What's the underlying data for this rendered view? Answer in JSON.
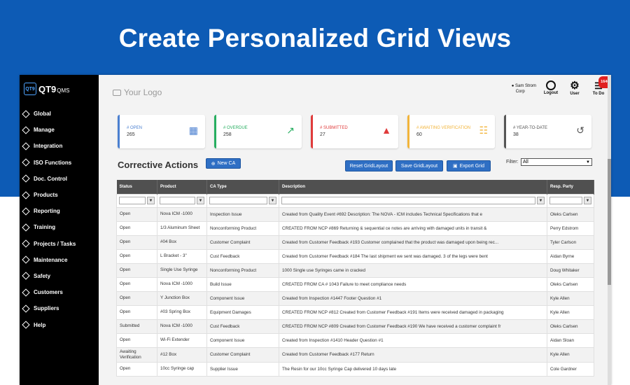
{
  "banner": {
    "title": "Create Personalized Grid Views"
  },
  "app": {
    "logo": {
      "badge": "QT9",
      "name": "QT9",
      "suffix": "QMS"
    },
    "your_logo": "Your Logo",
    "user": {
      "name": "Sam Strom",
      "org": "Corp"
    },
    "toolbar": {
      "logout": "Logout",
      "user": "User",
      "todo": "To Do",
      "todo_count": "1640"
    },
    "nav": [
      "Global",
      "Manage",
      "Integration",
      "ISO Functions",
      "Doc. Control",
      "Products",
      "Reporting",
      "Training",
      "Projects / Tasks",
      "Maintenance",
      "Safety",
      "Customers",
      "Suppliers",
      "Help"
    ],
    "cards": [
      {
        "label": "# OPEN",
        "value": "265",
        "color": "#4a7fd0",
        "icon": "calendar-icon"
      },
      {
        "label": "# OVERDUE",
        "value": "258",
        "color": "#27ae60",
        "icon": "trend-icon"
      },
      {
        "label": "# SUBMITTED",
        "value": "27",
        "color": "#e03b3b",
        "icon": "warning-icon"
      },
      {
        "label": "# AWAITING VERIFICATION",
        "value": "60",
        "color": "#f2b43a",
        "icon": "checklist-icon"
      },
      {
        "label": "# YEAR-TO-DATE",
        "value": "38",
        "color": "#555555",
        "icon": "history-icon"
      }
    ],
    "page_title": "Corrective Actions",
    "buttons": {
      "new_ca": "New CA",
      "reset": "Reset GridLayout",
      "save": "Save GridLayout",
      "export": "Export Grid"
    },
    "filter": {
      "label": "Filter:",
      "value": "All"
    },
    "grid": {
      "columns": [
        "Status",
        "Product",
        "CA Type",
        "Description",
        "Resp. Party"
      ],
      "rows": [
        [
          "Open",
          "Nova ICM -1000",
          "Inspection Issue",
          "Created from Quality Event #692 Description: The NOVA - ICM includes Technical Specifications that e",
          "Oleks Carlsen"
        ],
        [
          "Open",
          "1/3 Aluminum Sheet",
          "Nonconforming Product",
          "CREATED FROM NCP #869 Returning & sequential ce notes are arriving with damaged units in transit &",
          "Perry Edstrom"
        ],
        [
          "Open",
          "#04 Box",
          "Customer Complaint",
          "Created from Customer Feedback #193 Customer complained that the product was damaged upon being rec...",
          "Tyler Carlson"
        ],
        [
          "Open",
          "L Bracket - 3\"",
          "Cust Feedback",
          "Created from Customer Feedback #184 The last shipment we sent was damaged. 3 of the legs were bent",
          "Aidan Byrne"
        ],
        [
          "Open",
          "Single Use Syringe",
          "Nonconforming Product",
          "1000 Single use Syringes came in cracked",
          "Doug Whitaker"
        ],
        [
          "Open",
          "Nova ICM -1000",
          "Build Issue",
          "CREATED FROM CA # 1043 Failure to meet compliance needs",
          "Oleks Carlsen"
        ],
        [
          "Open",
          "Y Junction Box",
          "Component Issue",
          "Created from Inspection #1447 Footer Question #1",
          "Kyle Allen"
        ],
        [
          "Open",
          "#03 Spring Box",
          "Equipment Damages",
          "CREATED FROM NCP #812 Created from Customer Feedback #191 Items were received damaged in packaging",
          "Kyle Allen"
        ],
        [
          "Submitted",
          "Nova ICM -1000",
          "Cust Feedback",
          "CREATED FROM NCP #809 Created from Customer Feedback #190 We have received a customer complaint fr",
          "Oleks Carlsen"
        ],
        [
          "Open",
          "Wi-Fi Extender",
          "Component Issue",
          "Created from Inspection #1410 Header Question #1",
          "Aidan Sloan"
        ],
        [
          "Awaiting Verification",
          "#12 Box",
          "Customer Complaint",
          "Created from Customer Feedback #177 Return",
          "Kyle Allen"
        ],
        [
          "Open",
          "10cc Syringe cap",
          "Supplier Issue",
          "The Resin for our 10cc Syringe Cap delivered 10 days late",
          "Cole Gardner"
        ]
      ]
    }
  }
}
